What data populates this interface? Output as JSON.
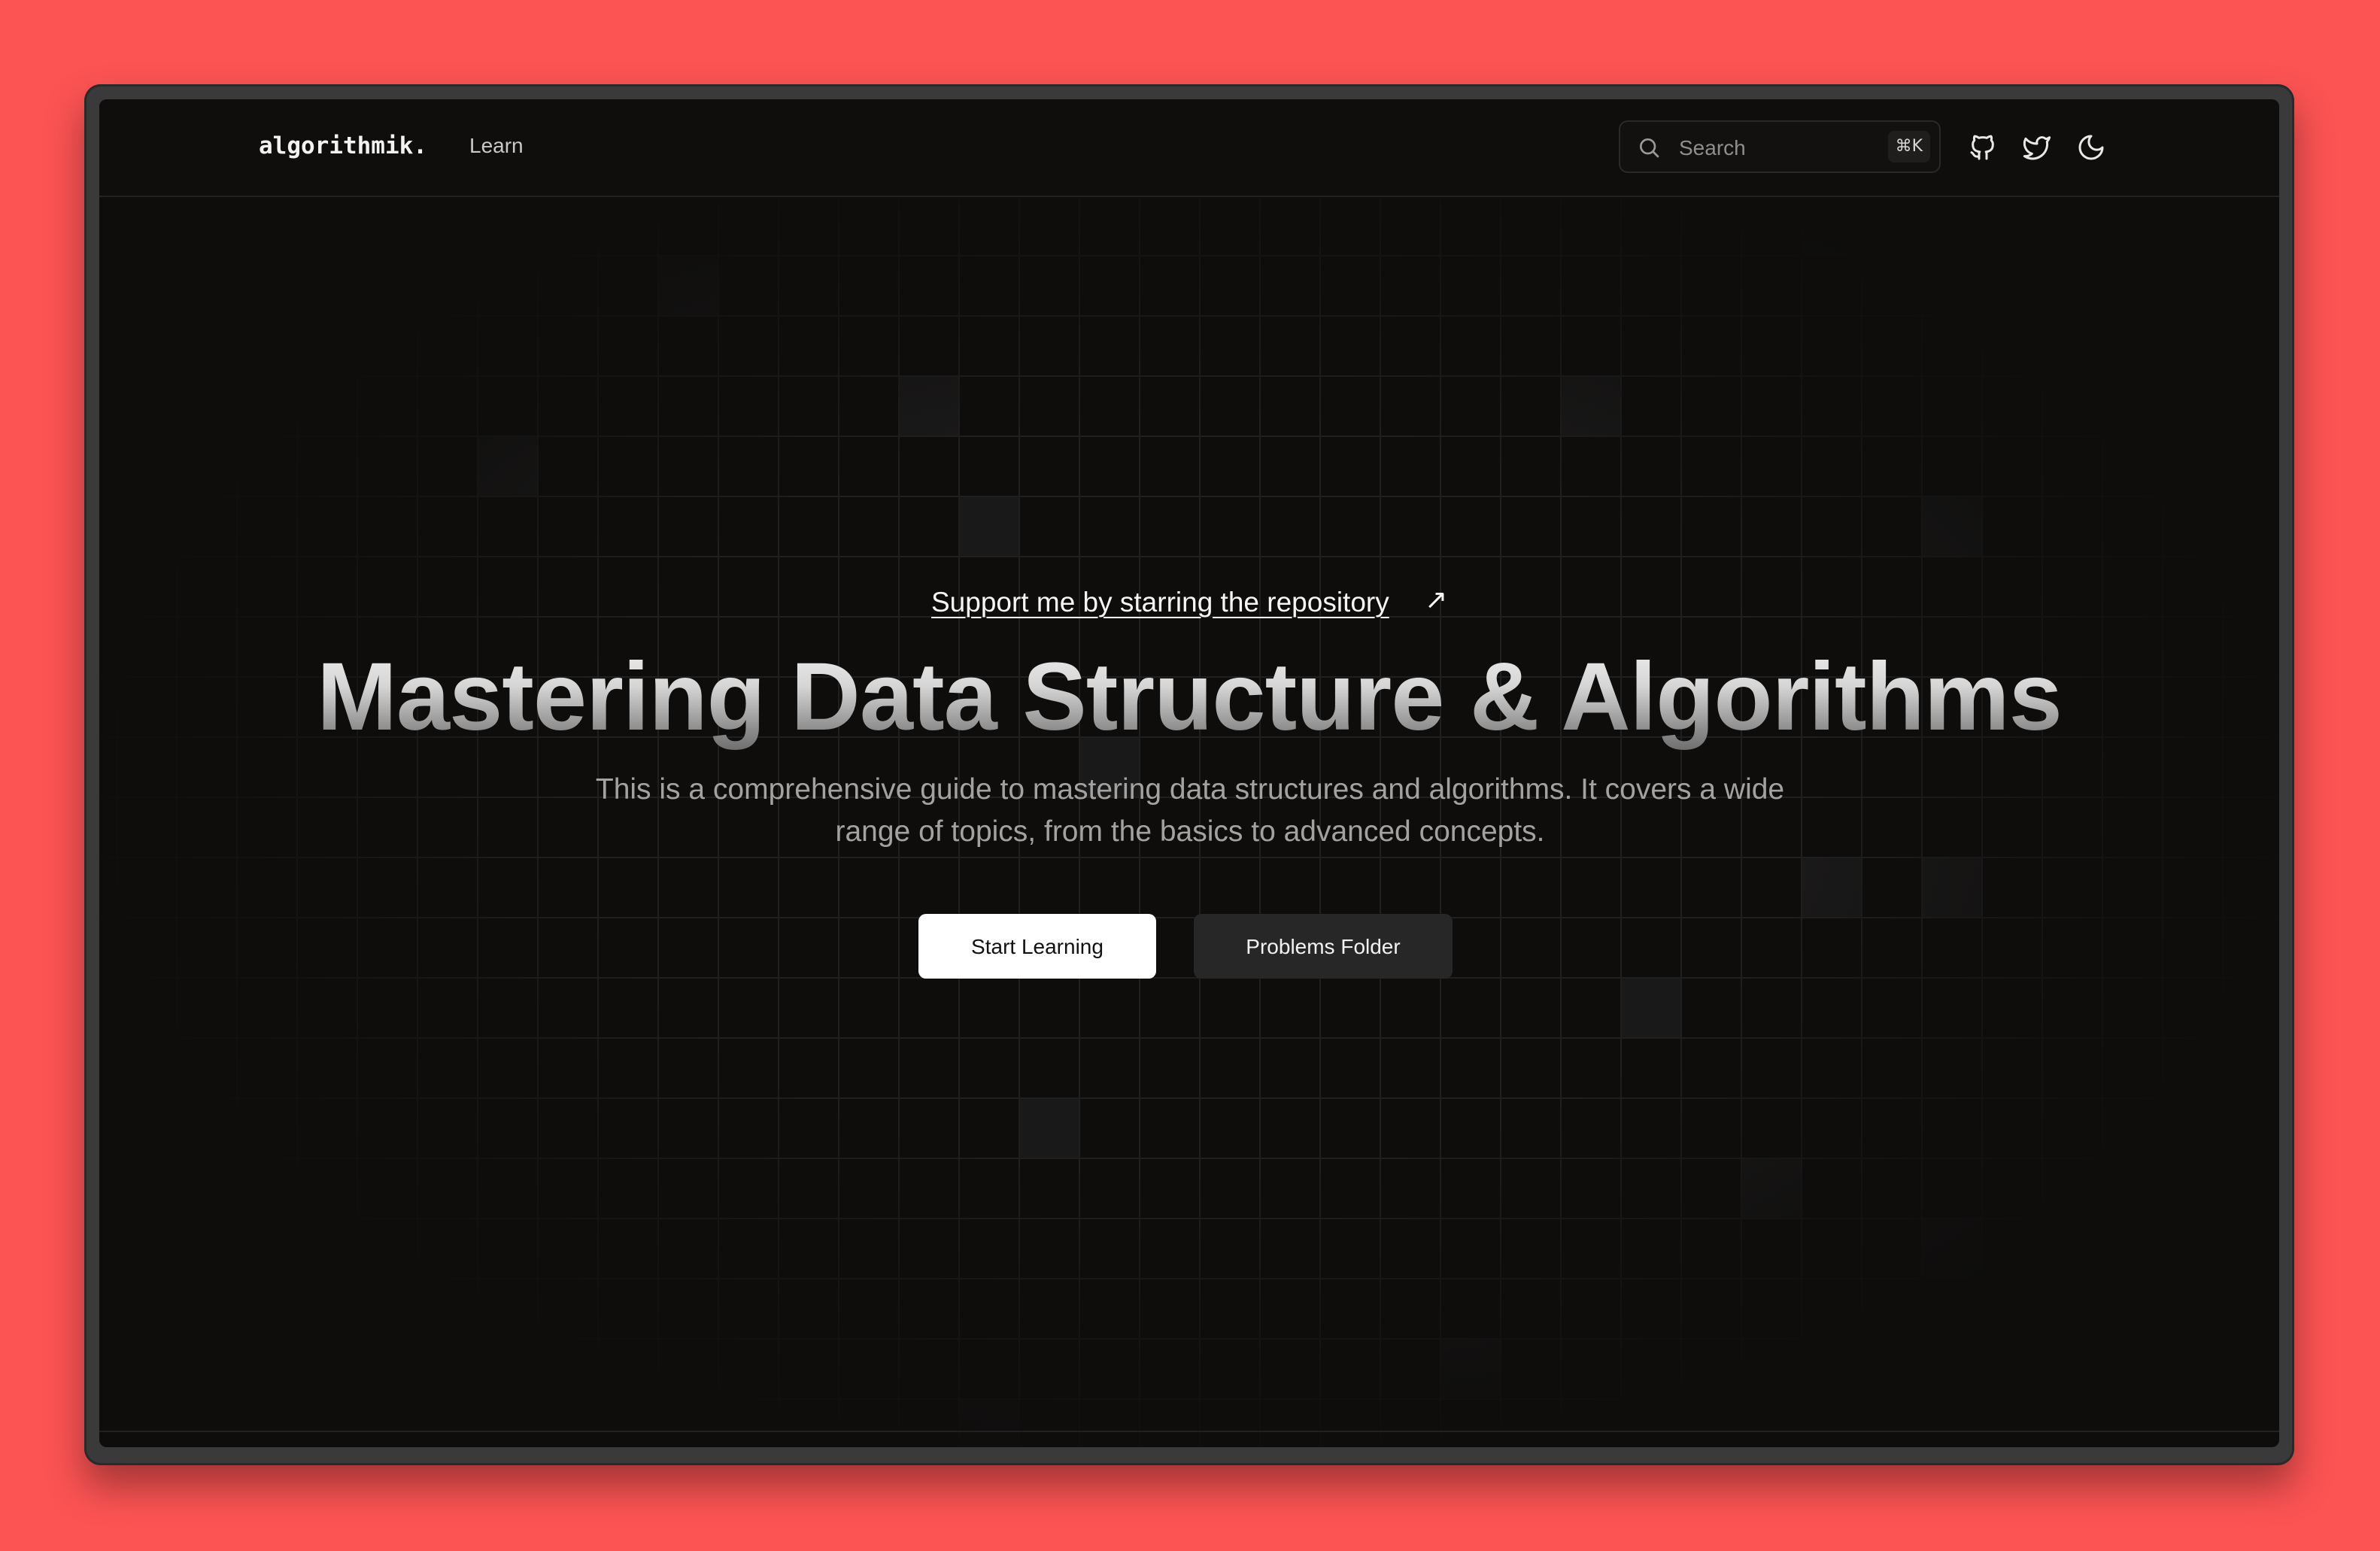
{
  "header": {
    "logo": "algorithmik.",
    "nav": {
      "learn_label": "Learn"
    },
    "search": {
      "placeholder": "Search",
      "shortcut": "⌘K"
    },
    "icons": [
      "github-icon",
      "twitter-icon",
      "moon-icon"
    ]
  },
  "hero": {
    "support_link": "Support me by starring the repository",
    "support_arrow": "↗",
    "title": "Mastering Data Structure & Algorithms",
    "description": "This is a comprehensive guide to mastering data structures and algorithms. It covers a wide range of topics, from the basics to advanced concepts.",
    "primary_button": "Start Learning",
    "secondary_button": "Problems Folder"
  },
  "colors": {
    "page_background": "#fc5353",
    "app_background": "#0e0d0c",
    "grid_line": "#1f1f1f",
    "primary_button_bg": "#ffffff",
    "secondary_button_bg": "#272727"
  }
}
